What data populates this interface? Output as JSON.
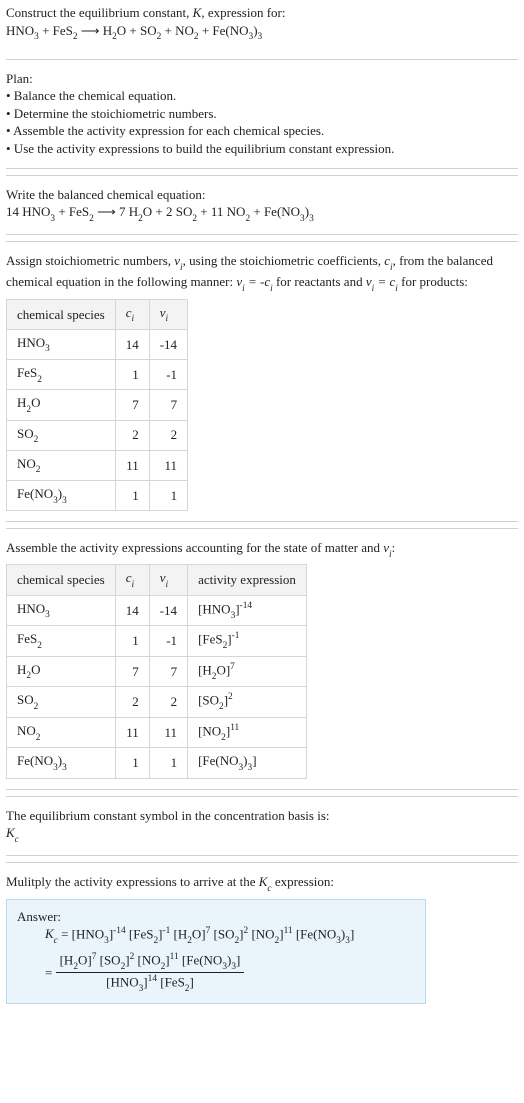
{
  "s1": {
    "title_a": "Construct the equilibrium constant, ",
    "title_b": ", expression for:",
    "equation_prefix": "HNO",
    "equation_rest": " + FeS",
    "arrow": " ⟶ ",
    "prod": "H",
    "prod2": "O + SO",
    "prod3": " + NO",
    "prod4": " + Fe(NO"
  },
  "plan": {
    "head": "Plan:",
    "b1": "• Balance the chemical equation.",
    "b2": "• Determine the stoichiometric numbers.",
    "b3": "• Assemble the activity expression for each chemical species.",
    "b4": "• Use the activity expressions to build the equilibrium constant expression."
  },
  "balanced": {
    "head": "Write the balanced chemical equation:",
    "c1": "14 HNO",
    "c2": " + FeS",
    "c3": " ⟶  7 H",
    "c4": "O + 2 SO",
    "c5": " + 11 NO",
    "c6": " + Fe(NO"
  },
  "stoich": {
    "intro_a": "Assign stoichiometric numbers, ",
    "intro_b": ", using the stoichiometric coefficients, ",
    "intro_c": ", from the balanced chemical equation in the following manner: ",
    "intro_d": " for reactants and ",
    "intro_e": " for products:",
    "h1": "chemical species",
    "h2": "c",
    "h3": "ν",
    "rows": [
      {
        "sp": "HNO₃",
        "c": "14",
        "v": "-14"
      },
      {
        "sp": "FeS₂",
        "c": "1",
        "v": "-1"
      },
      {
        "sp": "H₂O",
        "c": "7",
        "v": "7"
      },
      {
        "sp": "SO₂",
        "c": "2",
        "v": "2"
      },
      {
        "sp": "NO₂",
        "c": "11",
        "v": "11"
      },
      {
        "sp": "Fe(NO₃)₃",
        "c": "1",
        "v": "1"
      }
    ]
  },
  "activity": {
    "intro_a": "Assemble the activity expressions accounting for the state of matter and ",
    "intro_b": ":",
    "h4": "activity expression",
    "rows": [
      {
        "sp": "HNO₃",
        "c": "14",
        "v": "-14",
        "ae": "[HNO₃]⁻¹⁴"
      },
      {
        "sp": "FeS₂",
        "c": "1",
        "v": "-1",
        "ae": "[FeS₂]⁻¹"
      },
      {
        "sp": "H₂O",
        "c": "7",
        "v": "7",
        "ae": "[H₂O]⁷"
      },
      {
        "sp": "SO₂",
        "c": "2",
        "v": "2",
        "ae": "[SO₂]²"
      },
      {
        "sp": "NO₂",
        "c": "11",
        "v": "11",
        "ae": "[NO₂]¹¹"
      },
      {
        "sp": "Fe(NO₃)₃",
        "c": "1",
        "v": "1",
        "ae": "[Fe(NO₃)₃]"
      }
    ]
  },
  "ksym": {
    "line1": "The equilibrium constant symbol in the concentration basis is:",
    "sym": "K",
    "sub": "c"
  },
  "mult": {
    "line": "Mulitply the activity expressions to arrive at the ",
    "tail": " expression:"
  },
  "answer": {
    "label": "Answer:",
    "lhs": "K",
    "eq": " = [HNO₃]⁻¹⁴ [FeS₂]⁻¹ [H₂O]⁷ [SO₂]² [NO₂]¹¹ [Fe(NO₃)₃]",
    "numer": "[H₂O]⁷ [SO₂]² [NO₂]¹¹ [Fe(NO₃)₃]",
    "denom": "[HNO₃]¹⁴ [FeS₂]"
  }
}
